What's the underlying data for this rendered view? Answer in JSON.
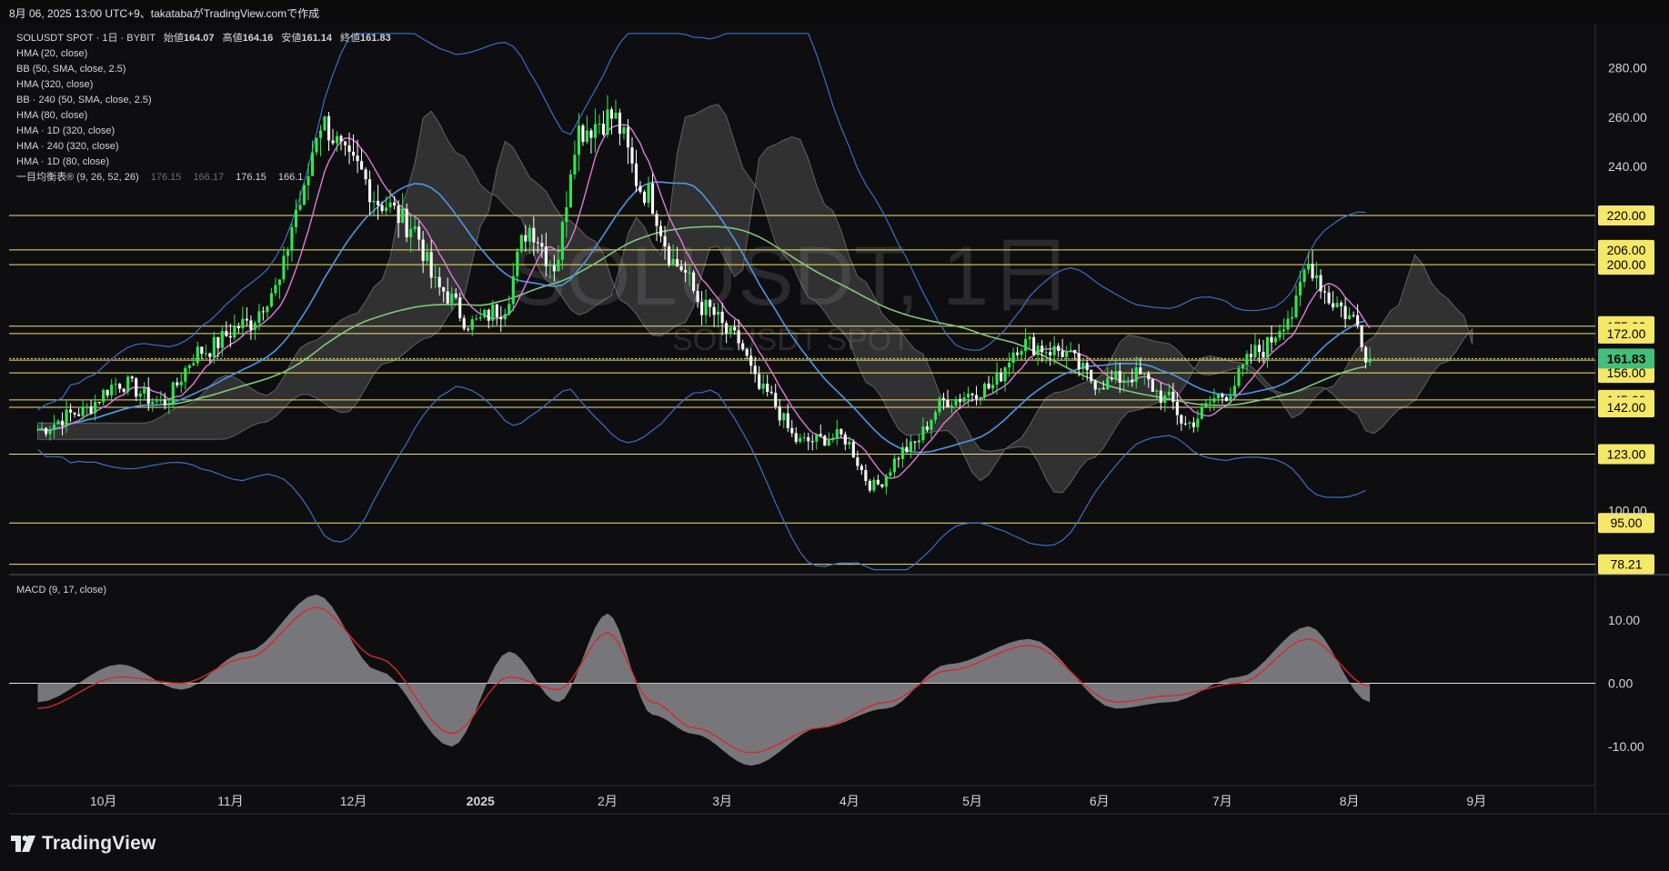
{
  "header": {
    "timestamp": "8月 06, 2025 13:00 UTC+9、takatabaがTradingView.comで作成"
  },
  "legend": {
    "symbol_line": "SOLUSDT SPOT · 1日 · BYBIT",
    "ohlc": [
      {
        "label": "始値",
        "value": "164.07"
      },
      {
        "label": "高値",
        "value": "164.16"
      },
      {
        "label": "安値",
        "value": "161.14"
      },
      {
        "label": "終値",
        "value": "161.83"
      }
    ],
    "indicators": [
      "HMA (20, close)",
      "BB (50, SMA, close, 2.5)",
      "HMA (320, close)",
      "BB · 240 (50, SMA, close, 2.5)",
      "HMA (80, close)",
      "HMA · 1D (320, close)",
      "HMA · 240 (320, close)",
      "HMA · 1D (80, close)"
    ],
    "ichimoku_label": "一目均衡表® (9, 26, 52, 26)",
    "ichimoku_values": [
      "176.15",
      "166.17",
      "176.15",
      "166.1"
    ],
    "macd_label": "MACD (9, 17, close)"
  },
  "watermark": {
    "symbol": "SOLUSDT, 1日",
    "subtitle": "SOLUSDT SPOT"
  },
  "brand": {
    "name": "TradingView"
  },
  "colors": {
    "background": "#0e0e10",
    "up_candle": "#2ee84f",
    "down_candle": "#ffffff",
    "hma20": "#e07ad8",
    "hma80": "#4a98e8",
    "hma320": "#7fc87a",
    "bollinger": "#3b6fc8",
    "level_line": "#f2e36b",
    "level_tag": "#f5e768",
    "price_tag": "#42c07a",
    "macd_hist": "#8a8a8e",
    "macd_signal": "#d42a2a",
    "cloud": "#8c8c8c"
  },
  "chart_data": [
    {
      "type": "candlestick",
      "title": "SOLUSDT SPOT · 1日 · BYBIT",
      "x_tick_labels": [
        "10月",
        "11月",
        "12月",
        "2025",
        "2月",
        "3月",
        "4月",
        "5月",
        "6月",
        "7月",
        "8月",
        "9月"
      ],
      "y_tick_labels": [
        "100.00",
        "240.00",
        "260.00",
        "280.00"
      ],
      "ylim": [
        74,
        298
      ],
      "last_price": 161.83,
      "horizontal_levels": [
        220.0,
        206.0,
        200.0,
        175.0,
        172.0,
        161.2,
        156.0,
        145.0,
        142.0,
        123.0,
        95.0,
        78.21
      ],
      "level_labels": [
        "220.00",
        "206.00",
        "200.00",
        "175.00",
        "172.00",
        "161.83",
        "161.20",
        "156.00",
        "145.00",
        "142.00",
        "123.00",
        "95.00",
        "78.21"
      ],
      "close_path": {
        "x": [
          "2024-09-15",
          "2024-09-25",
          "2024-10-05",
          "2024-10-15",
          "2024-10-25",
          "2024-11-05",
          "2024-11-12",
          "2024-11-18",
          "2024-11-23",
          "2024-12-01",
          "2024-12-08",
          "2024-12-15",
          "2024-12-22",
          "2024-12-30",
          "2025-01-06",
          "2025-01-13",
          "2025-01-19",
          "2025-01-25",
          "2025-02-02",
          "2025-02-10",
          "2025-02-18",
          "2025-02-25",
          "2025-03-04",
          "2025-03-11",
          "2025-03-20",
          "2025-03-30",
          "2025-04-07",
          "2025-04-15",
          "2025-04-25",
          "2025-05-05",
          "2025-05-13",
          "2025-05-22",
          "2025-06-01",
          "2025-06-10",
          "2025-06-18",
          "2025-06-22",
          "2025-07-01",
          "2025-07-10",
          "2025-07-18",
          "2025-07-22",
          "2025-07-28",
          "2025-08-02",
          "2025-08-06"
        ],
        "y": [
          133,
          140,
          152,
          144,
          165,
          176,
          190,
          225,
          258,
          240,
          225,
          216,
          190,
          176,
          182,
          215,
          200,
          255,
          260,
          230,
          200,
          182,
          170,
          148,
          128,
          130,
          110,
          125,
          145,
          150,
          168,
          165,
          152,
          155,
          145,
          135,
          147,
          165,
          180,
          200,
          185,
          178,
          161.83
        ]
      },
      "series": [
        {
          "name": "HMA (20, close)",
          "color": "#e07ad8"
        },
        {
          "name": "HMA (80, close)",
          "color": "#4a98e8"
        },
        {
          "name": "HMA (320, close)",
          "color": "#7fc87a"
        },
        {
          "name": "BB (50, SMA, close, 2.5)",
          "color": "#3b6fc8"
        }
      ]
    },
    {
      "type": "area",
      "title": "MACD (9, 17, close)",
      "y_tick_labels": [
        "10.00",
        "0.00",
        "-10.00"
      ],
      "ylim": [
        -16,
        17
      ],
      "x": [
        "2024-09-15",
        "2024-10-05",
        "2024-10-20",
        "2024-11-05",
        "2024-11-22",
        "2024-12-07",
        "2024-12-25",
        "2025-01-08",
        "2025-01-20",
        "2025-02-01",
        "2025-02-12",
        "2025-02-22",
        "2025-03-08",
        "2025-03-25",
        "2025-04-10",
        "2025-04-25",
        "2025-05-15",
        "2025-06-05",
        "2025-06-18",
        "2025-07-05",
        "2025-07-22",
        "2025-08-06"
      ],
      "histogram": [
        -3,
        3,
        -1,
        5,
        14,
        2,
        -10,
        5,
        -3,
        11,
        -5,
        -8,
        -13,
        -7,
        -4,
        3,
        7,
        -4,
        -3,
        1,
        9,
        -3
      ],
      "signal": [
        -4,
        1,
        0,
        4,
        12,
        4,
        -8,
        1,
        -1,
        8,
        -3,
        -7,
        -11,
        -7,
        -3,
        2,
        6,
        -3,
        -2,
        0,
        7,
        -0.5
      ]
    }
  ]
}
